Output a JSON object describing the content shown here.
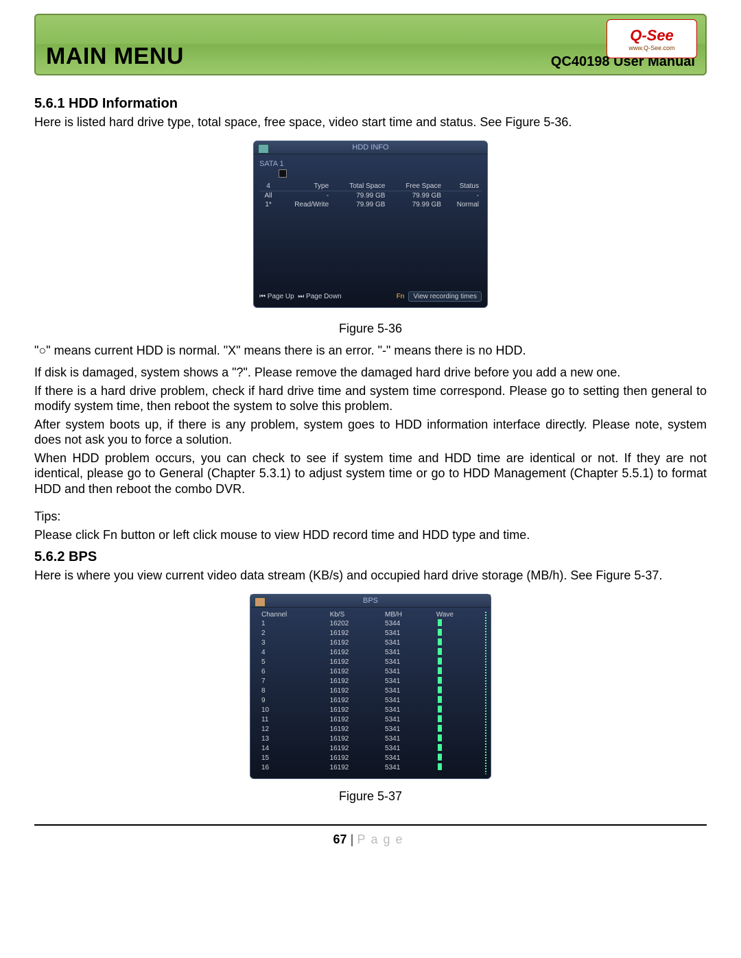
{
  "header": {
    "main_title": "MAIN MENU",
    "subtitle": "QC40198 User Manual",
    "logo_brand": "Q-See",
    "logo_url": "www.Q-See.com"
  },
  "section_hdd": {
    "heading": "5.6.1  HDD Information",
    "intro": "Here is listed hard drive type, total space, free space, video start time and status. See Figure 5-36.",
    "caption": "Figure 5-36",
    "legend_line": "\"○\" means current HDD is normal. \"X\" means there is an error. \"-\" means there is no HDD.",
    "para_damaged": "If disk is damaged, system shows a \"?\". Please remove the damaged hard drive before you add a new one.",
    "para_problem": "If there is a hard drive problem, check if hard drive time and system time correspond. Please go to setting then general to modify system time, then reboot the system to solve this problem.",
    "para_boot": "After system boots up, if there is any problem, system goes to HDD information interface directly. Please note, system does not ask you to force a solution.",
    "para_identical": "When HDD problem occurs, you can check to see if system time and HDD time are identical or not. If they are not identical, please go to General (Chapter 5.3.1) to adjust system time or go to HDD Management (Chapter 5.5.1) to format HDD and then reboot the combo DVR.",
    "tips_label": "Tips:",
    "tips_body": "Please click Fn button or left click mouse to view HDD record time and HDD type and time."
  },
  "hdd_panel": {
    "title": "HDD INFO",
    "sata_label": "SATA 1",
    "columns": [
      "4",
      "Type",
      "Total Space",
      "Free Space",
      "Status"
    ],
    "rows": [
      {
        "c1": "All",
        "type": "-",
        "total": "79.99 GB",
        "free": "79.99 GB",
        "status": "-"
      },
      {
        "c1": "1*",
        "type": "Read/Write",
        "total": "79.99 GB",
        "free": "79.99 GB",
        "status": "Normal"
      }
    ],
    "page_up": "⏮ Page Up",
    "page_down": "⏭ Page Down",
    "fn": "Fn",
    "view_btn": "View recording times"
  },
  "section_bps": {
    "heading": "5.6.2  BPS",
    "intro": "Here is where you view current video data stream (KB/s) and occupied hard drive storage (MB/h). See Figure 5-37.",
    "caption": "Figure 5-37"
  },
  "bps_panel": {
    "title": "BPS",
    "columns": [
      "Channel",
      "Kb/S",
      "MB/H",
      "Wave"
    ]
  },
  "chart_data": {
    "type": "table",
    "title": "BPS",
    "columns": [
      "Channel",
      "Kb/S",
      "MB/H"
    ],
    "rows": [
      {
        "channel": "1",
        "kbs": 16202,
        "mbh": 5344
      },
      {
        "channel": "2",
        "kbs": 16192,
        "mbh": 5341
      },
      {
        "channel": "3",
        "kbs": 16192,
        "mbh": 5341
      },
      {
        "channel": "4",
        "kbs": 16192,
        "mbh": 5341
      },
      {
        "channel": "5",
        "kbs": 16192,
        "mbh": 5341
      },
      {
        "channel": "6",
        "kbs": 16192,
        "mbh": 5341
      },
      {
        "channel": "7",
        "kbs": 16192,
        "mbh": 5341
      },
      {
        "channel": "8",
        "kbs": 16192,
        "mbh": 5341
      },
      {
        "channel": "9",
        "kbs": 16192,
        "mbh": 5341
      },
      {
        "channel": "10",
        "kbs": 16192,
        "mbh": 5341
      },
      {
        "channel": "11",
        "kbs": 16192,
        "mbh": 5341
      },
      {
        "channel": "12",
        "kbs": 16192,
        "mbh": 5341
      },
      {
        "channel": "13",
        "kbs": 16192,
        "mbh": 5341
      },
      {
        "channel": "14",
        "kbs": 16192,
        "mbh": 5341
      },
      {
        "channel": "15",
        "kbs": 16192,
        "mbh": 5341
      },
      {
        "channel": "16",
        "kbs": 16192,
        "mbh": 5341
      }
    ]
  },
  "footer": {
    "page_num": "67",
    "sep": " | ",
    "word": "Page"
  }
}
